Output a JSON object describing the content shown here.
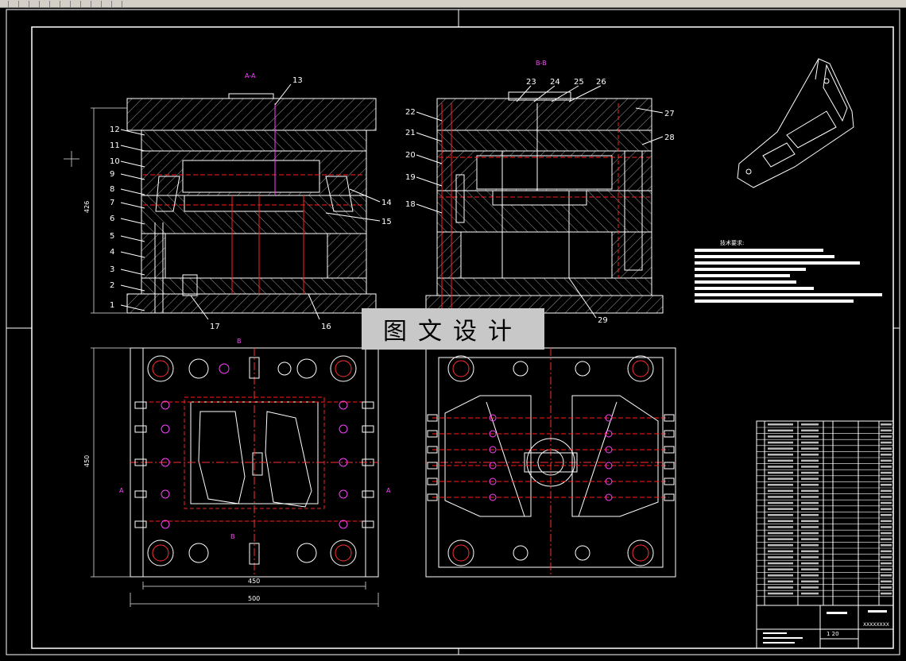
{
  "window": {
    "toolbar_icons": [
      "open-icon",
      "save-icon",
      "print-icon",
      "cut-icon",
      "copy-icon",
      "paste-icon",
      "undo-icon",
      "redo-icon",
      "pan-icon",
      "zoom-icon",
      "properties-icon",
      "layer-icon"
    ]
  },
  "drawing": {
    "section_a_label": "A-A",
    "section_b_label": "B-B",
    "stamp_text": "图文设计",
    "dim_height": "426",
    "dim_plan_height": "450",
    "dim_width_inner": "450",
    "dim_width_outer": "500",
    "view_marker_a": "A",
    "view_marker_b": "B",
    "tech_req_title": "技术要求:",
    "callouts_left": [
      "1",
      "2",
      "3",
      "4",
      "5",
      "6",
      "7",
      "8",
      "9",
      "10",
      "11",
      "12"
    ],
    "callout_13": "13",
    "callouts_right_a": [
      "14",
      "15"
    ],
    "callout_16": "16",
    "callout_17": "17",
    "callouts_b_left": [
      "18",
      "19",
      "20",
      "21",
      "22"
    ],
    "callouts_b_top": [
      "23",
      "24",
      "25",
      "26"
    ],
    "callouts_b_right": [
      "27",
      "28"
    ],
    "callout_29": "29",
    "title_block_sheet": "1 20",
    "title_block_code": "XXXXXXXX",
    "colors": {
      "line": "#ffffff",
      "hidden": "#ff2020",
      "center": "#ff3030",
      "accent": "#ff40ff",
      "hatch": "#bfbfbf",
      "dim": "#b0b0b0"
    }
  }
}
